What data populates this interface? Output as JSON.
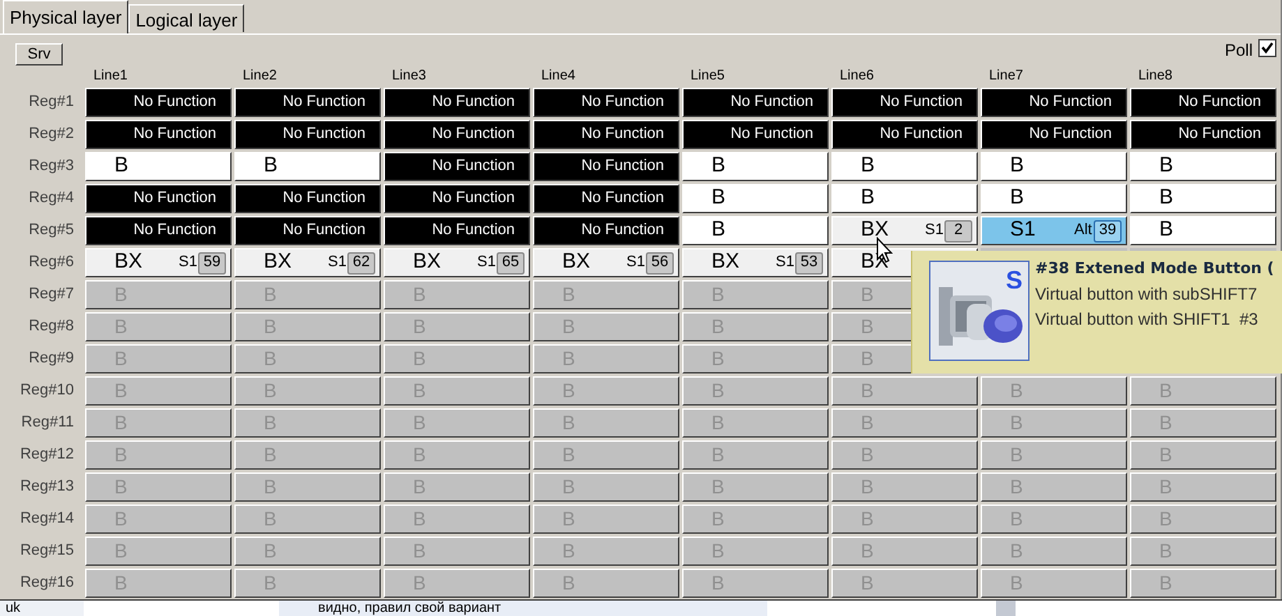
{
  "tabs": [
    {
      "label": "Physical layer",
      "selected": true
    },
    {
      "label": "Logical layer",
      "selected": false
    }
  ],
  "srv_button": "Srv",
  "poll": {
    "label": "Poll",
    "checked": true
  },
  "columns": [
    "Line1",
    "Line2",
    "Line3",
    "Line4",
    "Line5",
    "Line6",
    "Line7",
    "Line8"
  ],
  "rows": [
    {
      "label": "Reg#1",
      "cells": [
        {
          "kind": "none",
          "label": "No Function"
        },
        {
          "kind": "none",
          "label": "No Function"
        },
        {
          "kind": "none",
          "label": "No Function"
        },
        {
          "kind": "none",
          "label": "No Function"
        },
        {
          "kind": "none",
          "label": "No Function"
        },
        {
          "kind": "none",
          "label": "No Function"
        },
        {
          "kind": "none",
          "label": "No Function"
        },
        {
          "kind": "none",
          "label": "No Function"
        }
      ]
    },
    {
      "label": "Reg#2",
      "cells": [
        {
          "kind": "none",
          "label": "No Function"
        },
        {
          "kind": "none",
          "label": "No Function"
        },
        {
          "kind": "none",
          "label": "No Function"
        },
        {
          "kind": "none",
          "label": "No Function"
        },
        {
          "kind": "none",
          "label": "No Function"
        },
        {
          "kind": "none",
          "label": "No Function"
        },
        {
          "kind": "none",
          "label": "No Function"
        },
        {
          "kind": "none",
          "label": "No Function"
        }
      ]
    },
    {
      "label": "Reg#3",
      "cells": [
        {
          "kind": "b",
          "label": "B"
        },
        {
          "kind": "b",
          "label": "B"
        },
        {
          "kind": "none",
          "label": "No Function"
        },
        {
          "kind": "none",
          "label": "No Function"
        },
        {
          "kind": "b",
          "label": "B"
        },
        {
          "kind": "b",
          "label": "B"
        },
        {
          "kind": "b",
          "label": "B"
        },
        {
          "kind": "b",
          "label": "B"
        }
      ]
    },
    {
      "label": "Reg#4",
      "cells": [
        {
          "kind": "none",
          "label": "No Function"
        },
        {
          "kind": "none",
          "label": "No Function"
        },
        {
          "kind": "none",
          "label": "No Function"
        },
        {
          "kind": "none",
          "label": "No Function"
        },
        {
          "kind": "b",
          "label": "B"
        },
        {
          "kind": "b",
          "label": "B"
        },
        {
          "kind": "b",
          "label": "B"
        },
        {
          "kind": "b",
          "label": "B"
        }
      ]
    },
    {
      "label": "Reg#5",
      "cells": [
        {
          "kind": "none",
          "label": "No Function"
        },
        {
          "kind": "none",
          "label": "No Function"
        },
        {
          "kind": "none",
          "label": "No Function"
        },
        {
          "kind": "none",
          "label": "No Function"
        },
        {
          "kind": "b",
          "label": "B"
        },
        {
          "kind": "bx",
          "label": "BX",
          "shift": "S1",
          "num": "2"
        },
        {
          "kind": "alt",
          "label": "S1",
          "shift": "Alt",
          "num": "39"
        },
        {
          "kind": "b",
          "label": "B"
        }
      ]
    },
    {
      "label": "Reg#6",
      "cells": [
        {
          "kind": "bx",
          "label": "BX",
          "shift": "S1",
          "num": "59"
        },
        {
          "kind": "bx",
          "label": "BX",
          "shift": "S1",
          "num": "62"
        },
        {
          "kind": "bx",
          "label": "BX",
          "shift": "S1",
          "num": "65"
        },
        {
          "kind": "bx",
          "label": "BX",
          "shift": "S1",
          "num": "56"
        },
        {
          "kind": "bx",
          "label": "BX",
          "shift": "S1",
          "num": "53"
        },
        {
          "kind": "bx",
          "label": "BX"
        },
        {
          "kind": "covered"
        },
        {
          "kind": "covered"
        }
      ]
    },
    {
      "label": "Reg#7",
      "cells": [
        {
          "kind": "empty",
          "label": "B"
        },
        {
          "kind": "empty",
          "label": "B"
        },
        {
          "kind": "empty",
          "label": "B"
        },
        {
          "kind": "empty",
          "label": "B"
        },
        {
          "kind": "empty",
          "label": "B"
        },
        {
          "kind": "empty",
          "label": "B"
        },
        {
          "kind": "covered"
        },
        {
          "kind": "covered"
        }
      ]
    },
    {
      "label": "Reg#8",
      "cells": [
        {
          "kind": "empty",
          "label": "B"
        },
        {
          "kind": "empty",
          "label": "B"
        },
        {
          "kind": "empty",
          "label": "B"
        },
        {
          "kind": "empty",
          "label": "B"
        },
        {
          "kind": "empty",
          "label": "B"
        },
        {
          "kind": "empty",
          "label": "B"
        },
        {
          "kind": "covered"
        },
        {
          "kind": "covered"
        }
      ]
    },
    {
      "label": "Reg#9",
      "cells": [
        {
          "kind": "empty",
          "label": "B"
        },
        {
          "kind": "empty",
          "label": "B"
        },
        {
          "kind": "empty",
          "label": "B"
        },
        {
          "kind": "empty",
          "label": "B"
        },
        {
          "kind": "empty",
          "label": "B"
        },
        {
          "kind": "empty",
          "label": "B"
        },
        {
          "kind": "covered"
        },
        {
          "kind": "covered"
        }
      ]
    },
    {
      "label": "Reg#10",
      "cells": [
        {
          "kind": "empty",
          "label": "B"
        },
        {
          "kind": "empty",
          "label": "B"
        },
        {
          "kind": "empty",
          "label": "B"
        },
        {
          "kind": "empty",
          "label": "B"
        },
        {
          "kind": "empty",
          "label": "B"
        },
        {
          "kind": "empty",
          "label": "B"
        },
        {
          "kind": "empty",
          "label": "B"
        },
        {
          "kind": "empty",
          "label": "B"
        }
      ]
    },
    {
      "label": "Reg#11",
      "cells": [
        {
          "kind": "empty",
          "label": "B"
        },
        {
          "kind": "empty",
          "label": "B"
        },
        {
          "kind": "empty",
          "label": "B"
        },
        {
          "kind": "empty",
          "label": "B"
        },
        {
          "kind": "empty",
          "label": "B"
        },
        {
          "kind": "empty",
          "label": "B"
        },
        {
          "kind": "empty",
          "label": "B"
        },
        {
          "kind": "empty",
          "label": "B"
        }
      ]
    },
    {
      "label": "Reg#12",
      "cells": [
        {
          "kind": "empty",
          "label": "B"
        },
        {
          "kind": "empty",
          "label": "B"
        },
        {
          "kind": "empty",
          "label": "B"
        },
        {
          "kind": "empty",
          "label": "B"
        },
        {
          "kind": "empty",
          "label": "B"
        },
        {
          "kind": "empty",
          "label": "B"
        },
        {
          "kind": "empty",
          "label": "B"
        },
        {
          "kind": "empty",
          "label": "B"
        }
      ]
    },
    {
      "label": "Reg#13",
      "cells": [
        {
          "kind": "empty",
          "label": "B"
        },
        {
          "kind": "empty",
          "label": "B"
        },
        {
          "kind": "empty",
          "label": "B"
        },
        {
          "kind": "empty",
          "label": "B"
        },
        {
          "kind": "empty",
          "label": "B"
        },
        {
          "kind": "empty",
          "label": "B"
        },
        {
          "kind": "empty",
          "label": "B"
        },
        {
          "kind": "empty",
          "label": "B"
        }
      ]
    },
    {
      "label": "Reg#14",
      "cells": [
        {
          "kind": "empty",
          "label": "B"
        },
        {
          "kind": "empty",
          "label": "B"
        },
        {
          "kind": "empty",
          "label": "B"
        },
        {
          "kind": "empty",
          "label": "B"
        },
        {
          "kind": "empty",
          "label": "B"
        },
        {
          "kind": "empty",
          "label": "B"
        },
        {
          "kind": "empty",
          "label": "B"
        },
        {
          "kind": "empty",
          "label": "B"
        }
      ]
    },
    {
      "label": "Reg#15",
      "cells": [
        {
          "kind": "empty",
          "label": "B"
        },
        {
          "kind": "empty",
          "label": "B"
        },
        {
          "kind": "empty",
          "label": "B"
        },
        {
          "kind": "empty",
          "label": "B"
        },
        {
          "kind": "empty",
          "label": "B"
        },
        {
          "kind": "empty",
          "label": "B"
        },
        {
          "kind": "empty",
          "label": "B"
        },
        {
          "kind": "empty",
          "label": "B"
        }
      ]
    },
    {
      "label": "Reg#16",
      "cells": [
        {
          "kind": "empty",
          "label": "B"
        },
        {
          "kind": "empty",
          "label": "B"
        },
        {
          "kind": "empty",
          "label": "B"
        },
        {
          "kind": "empty",
          "label": "B"
        },
        {
          "kind": "empty",
          "label": "B"
        },
        {
          "kind": "empty",
          "label": "B"
        },
        {
          "kind": "empty",
          "label": "B"
        },
        {
          "kind": "empty",
          "label": "B"
        }
      ]
    }
  ],
  "tooltip": {
    "badge": "S",
    "title": "#38 Extened Mode Button (",
    "lines": [
      "Virtual button with subSHIFT7",
      "Virtual button with SHIFT1  #3"
    ]
  },
  "background_window": {
    "side_text": "uk",
    "text": "видно, правил свой вариант"
  }
}
